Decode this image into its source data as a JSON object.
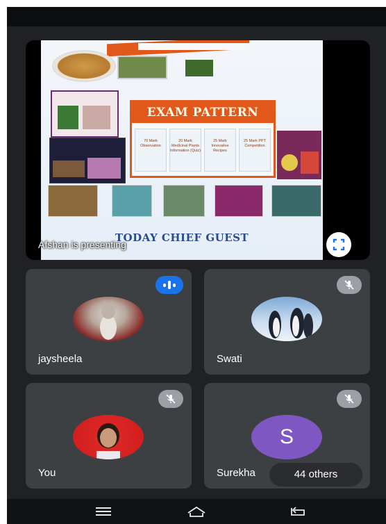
{
  "presentation": {
    "presenter_label": "Afshan is presenting",
    "slide": {
      "title": "EXAM PATTERN",
      "columns": [
        "70 Mark Observation",
        "20 Mark Medicinal Plants Information (Quiz)",
        "25 Mark Innovative Recipes",
        "25 Mark PPT Competition"
      ],
      "footer": "TODAY CHIEF GUEST"
    }
  },
  "participants": [
    {
      "name": "jaysheela",
      "status": "speaking"
    },
    {
      "name": "Swati",
      "status": "muted"
    },
    {
      "name": "You",
      "status": "muted"
    },
    {
      "name": "Surekha",
      "status": "muted",
      "initial": "S"
    }
  ],
  "others_label": "44 others",
  "colors": {
    "background": "#202124",
    "tile": "#3c4043",
    "speaking": "#1a73e8",
    "muted_badge": "#9aa0a6",
    "letter_avatar": "#7e57c2",
    "exam_accent": "#e2581b"
  },
  "icons": {
    "fullscreen": "fullscreen-icon",
    "mic_off": "mic-off-icon",
    "speaking": "audio-level-icon",
    "nav_menu": "menu-icon",
    "nav_home": "home-icon",
    "nav_back": "back-icon"
  }
}
